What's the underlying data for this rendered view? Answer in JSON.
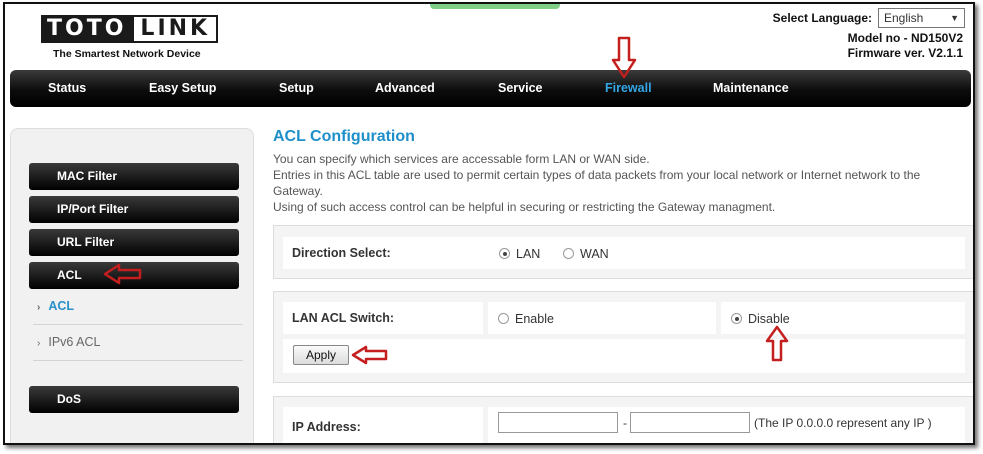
{
  "header": {
    "logo_part1": "TOTO",
    "logo_part2": "LINK",
    "tagline": "The Smartest Network Device",
    "language_label": "Select Language:",
    "language_value": "English",
    "model": "Model no - ND150V2",
    "firmware": "Firmware ver. V2.1.1"
  },
  "nav": {
    "items": [
      {
        "label": "Status"
      },
      {
        "label": "Easy Setup"
      },
      {
        "label": "Setup"
      },
      {
        "label": "Advanced"
      },
      {
        "label": "Service"
      },
      {
        "label": "Firewall"
      },
      {
        "label": "Maintenance"
      }
    ],
    "active": "Firewall",
    "active_color": "#33a6e6"
  },
  "sidebar": {
    "buttons": [
      {
        "label": "MAC Filter"
      },
      {
        "label": "IP/Port Filter"
      },
      {
        "label": "URL Filter"
      },
      {
        "label": "ACL"
      }
    ],
    "subitems": [
      {
        "label": "ACL"
      },
      {
        "label": "IPv6 ACL"
      }
    ],
    "dos_button": "DoS"
  },
  "main": {
    "title": "ACL Configuration",
    "desc_line1": "You can specify which services are accessable form LAN or WAN side.",
    "desc_line2": "Entries in this ACL table are used to permit certain types of data packets from your local network or Internet network to the Gateway.",
    "desc_line3": "Using of such access control can be helpful in securing or restricting the Gateway managment.",
    "direction": {
      "label": "Direction Select:",
      "option_lan": "LAN",
      "option_wan": "WAN",
      "selected": "LAN"
    },
    "switch": {
      "label": "LAN ACL Switch:",
      "option_enable": "Enable",
      "option_disable": "Disable",
      "selected": "Disable",
      "apply_label": "Apply"
    },
    "ip": {
      "label": "IP Address:",
      "start_value": "",
      "end_value": "",
      "separator": "-",
      "note": "(The IP 0.0.0.0 represent any IP )"
    }
  },
  "colors": {
    "title": "#1f8fca",
    "annotation_arrow": "#c41e1e"
  }
}
